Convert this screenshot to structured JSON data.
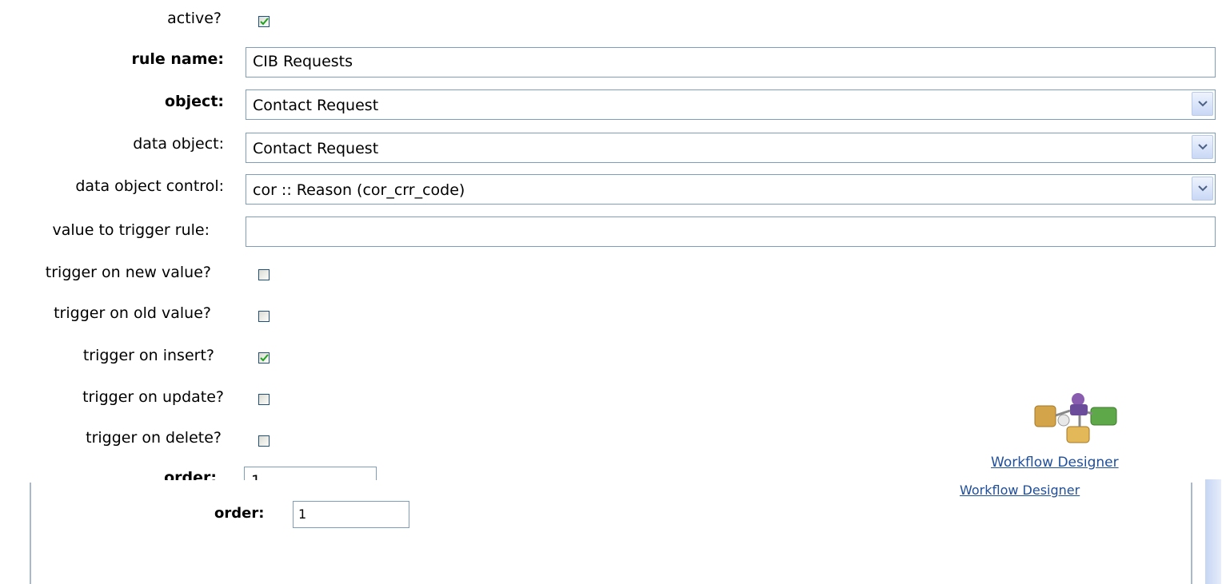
{
  "form": {
    "active": {
      "label": "active?",
      "checked": true
    },
    "rule_name": {
      "label": "rule name:",
      "value": "CIB Requests"
    },
    "object": {
      "label": "object:",
      "value": "Contact Request"
    },
    "data_object": {
      "label": "data object:",
      "value": "Contact Request"
    },
    "data_object_control": {
      "label": "data object control:",
      "value": "cor :: Reason (cor_crr_code)"
    },
    "value_to_trigger": {
      "label": "value to trigger rule:",
      "value": ""
    },
    "trigger_new": {
      "label": "trigger on new value?",
      "checked": false
    },
    "trigger_old": {
      "label": "trigger on old value?",
      "checked": false
    },
    "trigger_insert": {
      "label": "trigger on insert?",
      "checked": true
    },
    "trigger_update": {
      "label": "trigger on update?",
      "checked": false
    },
    "trigger_delete": {
      "label": "trigger on delete?",
      "checked": false
    },
    "order": {
      "label": "order:",
      "value": "1"
    }
  },
  "workflow": {
    "link_label": "Workflow Designer"
  },
  "lower": {
    "order_label": "order:",
    "order_value": "1",
    "workflow_link": "Workflow Designer"
  },
  "colors": {
    "border": "#7f9db9",
    "link": "#1f4e9a",
    "check": "#21a121"
  }
}
